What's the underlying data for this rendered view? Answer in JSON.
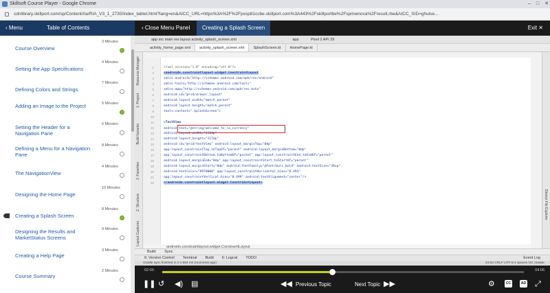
{
  "browser": {
    "window_title": "Skillsoft Course Player - Google Chrome",
    "url": "cdnlibrary.skillport.com/sp/Content/ria/RIA_V3_1_2730/index_tablet.html?lang=en&AICC_URL=https%3A%2F%2Fpxsp81ccbe.skillport.com%3A443%2Fskillportbe%2Fspmwnova%2Fresult.rbe&AICC_SID=ghulse..."
  },
  "header": {
    "menu_label": "Menu",
    "toc_label": "Table of Contents",
    "close_menu_label": "Close Menu Panel",
    "topic_title": "Creating a Splash Screen",
    "exit_label": "Exit"
  },
  "toc": [
    {
      "label": "Course Overview",
      "duration": "3 Minutes",
      "status": "done"
    },
    {
      "label": "Setting the App Specifications",
      "duration": "4 Minutes",
      "status": "open"
    },
    {
      "label": "Defining Colors and Strings",
      "duration": "7 Minutes",
      "status": "open"
    },
    {
      "label": "Adding an Image to the Project",
      "duration": "5 Minutes",
      "status": "done"
    },
    {
      "label": "Setting the Header for a Navigation Pane",
      "duration": "6 Minutes",
      "status": "open"
    },
    {
      "label": "Defining a Menu for a Navigation Pane",
      "duration": "8 Minutes",
      "status": "open"
    },
    {
      "label": "The NavigationView",
      "duration": "4 Minutes",
      "status": "open"
    },
    {
      "label": "Designing the Home Page",
      "duration": "10 Minutes",
      "status": "open"
    },
    {
      "label": "Creating a Splash Screen",
      "duration": "8 Minutes",
      "status": "done"
    },
    {
      "label": "Designing the Results and MarketStatus Screens",
      "duration": "9 Minutes",
      "status": "open"
    },
    {
      "label": "Creating a Help Page",
      "duration": "3 Minutes",
      "status": "open"
    },
    {
      "label": "Course Summary",
      "duration": "2 Minutes",
      "status": "open"
    }
  ],
  "ide": {
    "toolbar": "app  src  main  res  layout  activity_splash_screen.xml",
    "run_config": "app",
    "device": "Pixel 2 API 29",
    "tabs": [
      "activity_home_page.xml",
      "activity_splash_screen.xml",
      "SplashScreen.kt",
      "HomePage.kt"
    ],
    "left_strip": [
      "Resource Manager",
      "1: Project",
      "Build Variants",
      "2: Favorites",
      "Z: Structure",
      "Layout Captures"
    ],
    "right_strip": [
      "Device File Explorer"
    ],
    "line_numbers": [
      "1",
      "2",
      "3",
      "4",
      "5",
      "6",
      "7",
      "8",
      "9",
      "10",
      "11",
      "12",
      "13",
      "14",
      "15",
      "16",
      "17",
      "18",
      "19",
      "20",
      "21",
      "22"
    ],
    "code_lines": [
      "<?xml version=\"1.0\" encoding=\"utf-8\"?>",
      "<androidx.constraintlayout.widget.ConstraintLayout",
      "    xmlns:android=\"http://schemas.android.com/apk/res/android\"",
      "    xmlns:tools=\"http://schemas.android.com/tools\"",
      "    xmlns:app=\"http://schemas.android.com/apk/res-auto\"",
      "    android:id=\"@+id/drawer_layout\"",
      "    android:layout_width=\"match_parent\"",
      "    android:layout_height=\"match_parent\"",
      "    tools:context=\".SplashScreen\">",
      "",
      "    <TextView",
      "        android:text=\"@string/welcome_to_la_currency\"",
      "        android:layout_width=\"110dp\"",
      "        android:layout_height=\"117dp\"",
      "        android:id=\"@+id/textView\" android:layout_marginTop=\"0dp\"",
      "        app:layout_constraintTop_toTopOf=\"parent\" android:layout_marginBottom=\"0dp\"",
      "        app:layout_constraintBottom_toBottomOf=\"parent\" app:layout_constraintEnd_toEndOf=\"parent\"",
      "        android:layout_marginEnd=\"0dp\" app:layout_constraintStart_toStartOf=\"parent\"",
      "        android:layout_marginStart=\"0dp\" android:fontFamily=\"@font/muli_bold\" android:textSize=\"36sp\"",
      "        android:textColor=\"#FF0000\" app:layout_constraintHorizontal_bias=\"0.493\"",
      "        app:layout_constraintVertical_bias=\"0.499\" android:textAlignment=\"center\"/>",
      "</androidx.constraintlayout.widget.ConstraintLayout>"
    ],
    "breadcrumb": "androidx.constraintlayout.widget.ConstraintLayout",
    "build_label": "Build:",
    "sync_label": "Sync",
    "bottom_tabs": [
      "6: Version Control",
      "Terminal",
      "Build",
      "6: Logcat",
      "TODO"
    ],
    "event_log": "Event Log",
    "status_left": "Gradle sync finished in 2 s 604 ms (moments ago)",
    "status_right": "23:63  CRLF  UTF-8  4 spaces  Git: master"
  },
  "player": {
    "time_elapsed": "02:00",
    "time_total": "04:06",
    "progress": 0.47,
    "previous_label": "Previous Topic",
    "next_label": "Next Topic",
    "cc_label": "CC",
    "ad_label": "AD"
  }
}
